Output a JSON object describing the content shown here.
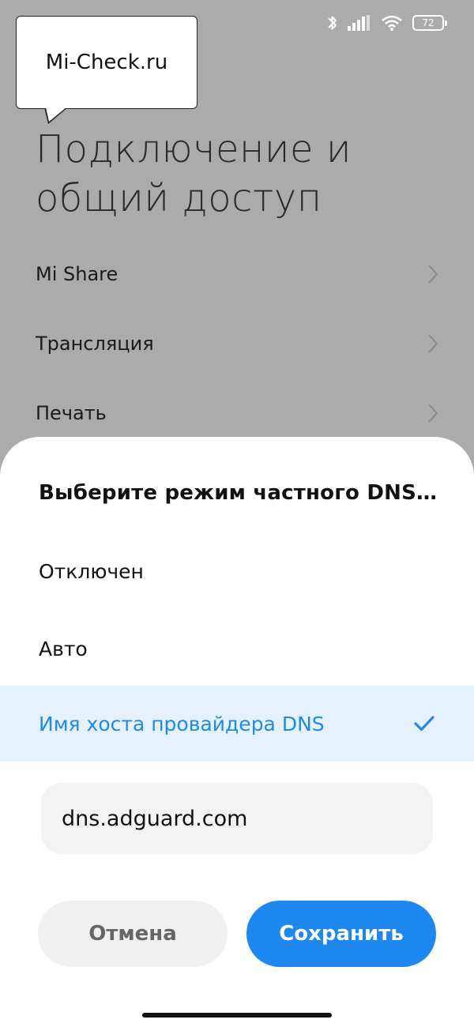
{
  "status_bar": {
    "icons": [
      "bluetooth-icon",
      "signal-icon",
      "wifi-icon",
      "battery-icon"
    ],
    "battery_level": "72"
  },
  "watermark": {
    "text": "Mi-Check.ru"
  },
  "page": {
    "title": "Подключение и общий доступ",
    "items": [
      {
        "label": "Mi Share"
      },
      {
        "label": "Трансляция"
      },
      {
        "label": "Печать"
      }
    ]
  },
  "dialog": {
    "title": "Выберите режим частного DNS-сервера",
    "options": [
      {
        "label": "Отключен",
        "selected": false
      },
      {
        "label": "Авто",
        "selected": false
      },
      {
        "label": "Имя хоста провайдера DNS",
        "selected": true
      }
    ],
    "hostname_value": "dns.adguard.com",
    "cancel_label": "Отмена",
    "save_label": "Сохранить"
  },
  "colors": {
    "accent": "#1f87f0",
    "selected_bg": "#e5f1fc",
    "dim_overlay": "#ababab"
  }
}
